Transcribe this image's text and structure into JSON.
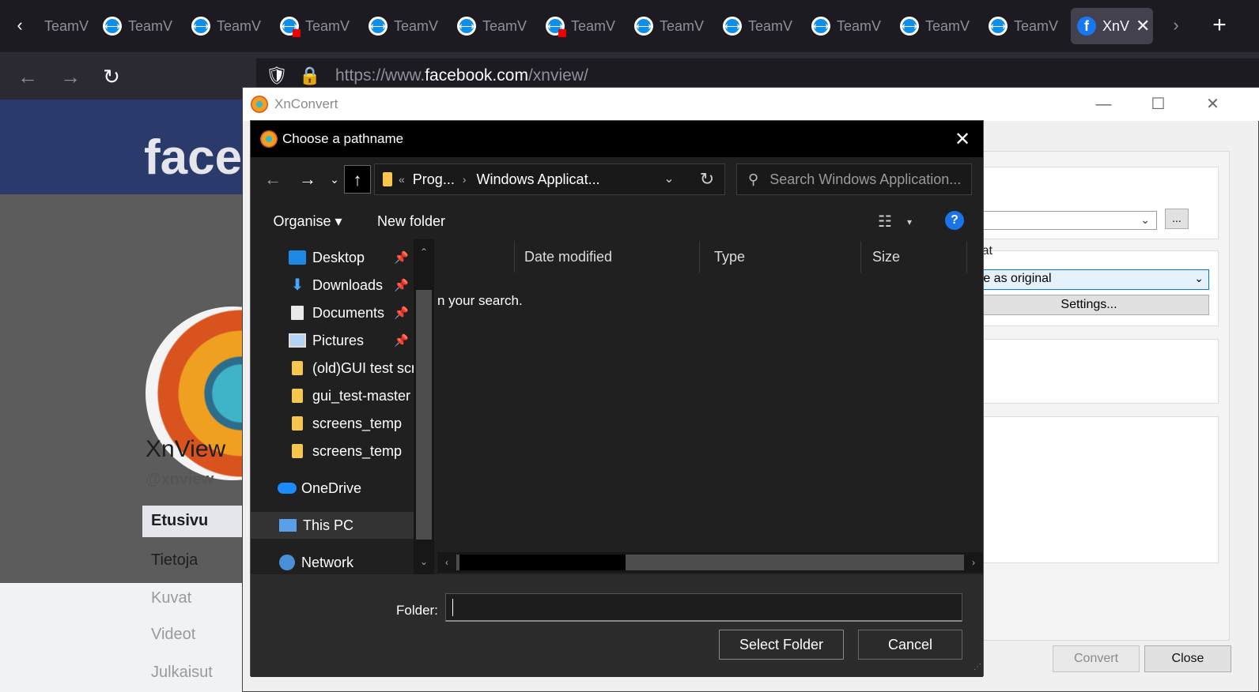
{
  "browser": {
    "tabs": [
      {
        "label": "TeamV",
        "badge": false
      },
      {
        "label": "TeamV",
        "badge": false
      },
      {
        "label": "TeamV",
        "badge": false
      },
      {
        "label": "TeamV",
        "badge": true
      },
      {
        "label": "TeamV",
        "badge": false
      },
      {
        "label": "TeamV",
        "badge": false
      },
      {
        "label": "TeamV",
        "badge": true
      },
      {
        "label": "TeamV",
        "badge": false
      },
      {
        "label": "TeamV",
        "badge": false
      },
      {
        "label": "TeamV",
        "badge": false
      },
      {
        "label": "TeamV",
        "badge": false
      },
      {
        "label": "TeamV",
        "badge": false
      }
    ],
    "active_tab": {
      "label": "XnV",
      "close": "✕"
    },
    "scroll_left": "‹",
    "scroll_right": "›",
    "new_tab": "+",
    "back": "←",
    "forward": "→",
    "reload": "↻",
    "url_prefix": "https://www.",
    "url_domain": "facebook.com",
    "url_path": "/xnview/",
    "shield_icon": "🛡",
    "lock_icon": "🔒"
  },
  "facebook": {
    "logo": "facel",
    "name": "XnView",
    "handle": "@xnview",
    "nav": [
      "Etusivu",
      "Tietoja",
      "Kuvat",
      "Videot",
      "Julkaisut"
    ]
  },
  "xnconvert": {
    "title": "XnConvert",
    "minimize": "—",
    "maximize": "☐",
    "close": "✕",
    "dots_button": "...",
    "format_label": "rmat",
    "format_value": "me as original",
    "settings_button": "Settings...",
    "convert_button": "Convert",
    "close_button": "Close"
  },
  "dialog": {
    "title": "Choose a pathname",
    "close": "✕",
    "back": "←",
    "forward": "→",
    "recent": "⌄",
    "up": "↑",
    "breadcrumb_overflow": "«",
    "breadcrumb": [
      "Prog...",
      "Windows Applicat..."
    ],
    "breadcrumb_sep": "›",
    "dropdown": "⌄",
    "refresh": "↻",
    "search_placeholder": "Search Windows Application...",
    "organise": "Organise ▾",
    "new_folder": "New folder",
    "view_icon": "☷",
    "view_drop": "▾",
    "help": "?",
    "nav_items": [
      {
        "label": "Desktop",
        "icon": "desktop",
        "pinned": true
      },
      {
        "label": "Downloads",
        "icon": "download",
        "pinned": true
      },
      {
        "label": "Documents",
        "icon": "doc",
        "pinned": true
      },
      {
        "label": "Pictures",
        "icon": "pic",
        "pinned": true
      },
      {
        "label": "(old)GUI test scri",
        "icon": "folder",
        "pinned": false
      },
      {
        "label": "gui_test-master",
        "icon": "folder",
        "pinned": false
      },
      {
        "label": "screens_temp",
        "icon": "folder",
        "pinned": false
      },
      {
        "label": "screens_temp",
        "icon": "folder",
        "pinned": false
      }
    ],
    "locations": [
      "OneDrive",
      "This PC",
      "Network"
    ],
    "pin": "📌",
    "columns": [
      "",
      "Date modified",
      "Type",
      "Size"
    ],
    "empty_message": "n your search.",
    "folder_label": "Folder:",
    "folder_value": "",
    "select_folder": "Select Folder",
    "cancel": "Cancel",
    "scroll_up": "⌃",
    "scroll_down": "⌄",
    "scroll_left": "‹",
    "scroll_right": "›"
  }
}
